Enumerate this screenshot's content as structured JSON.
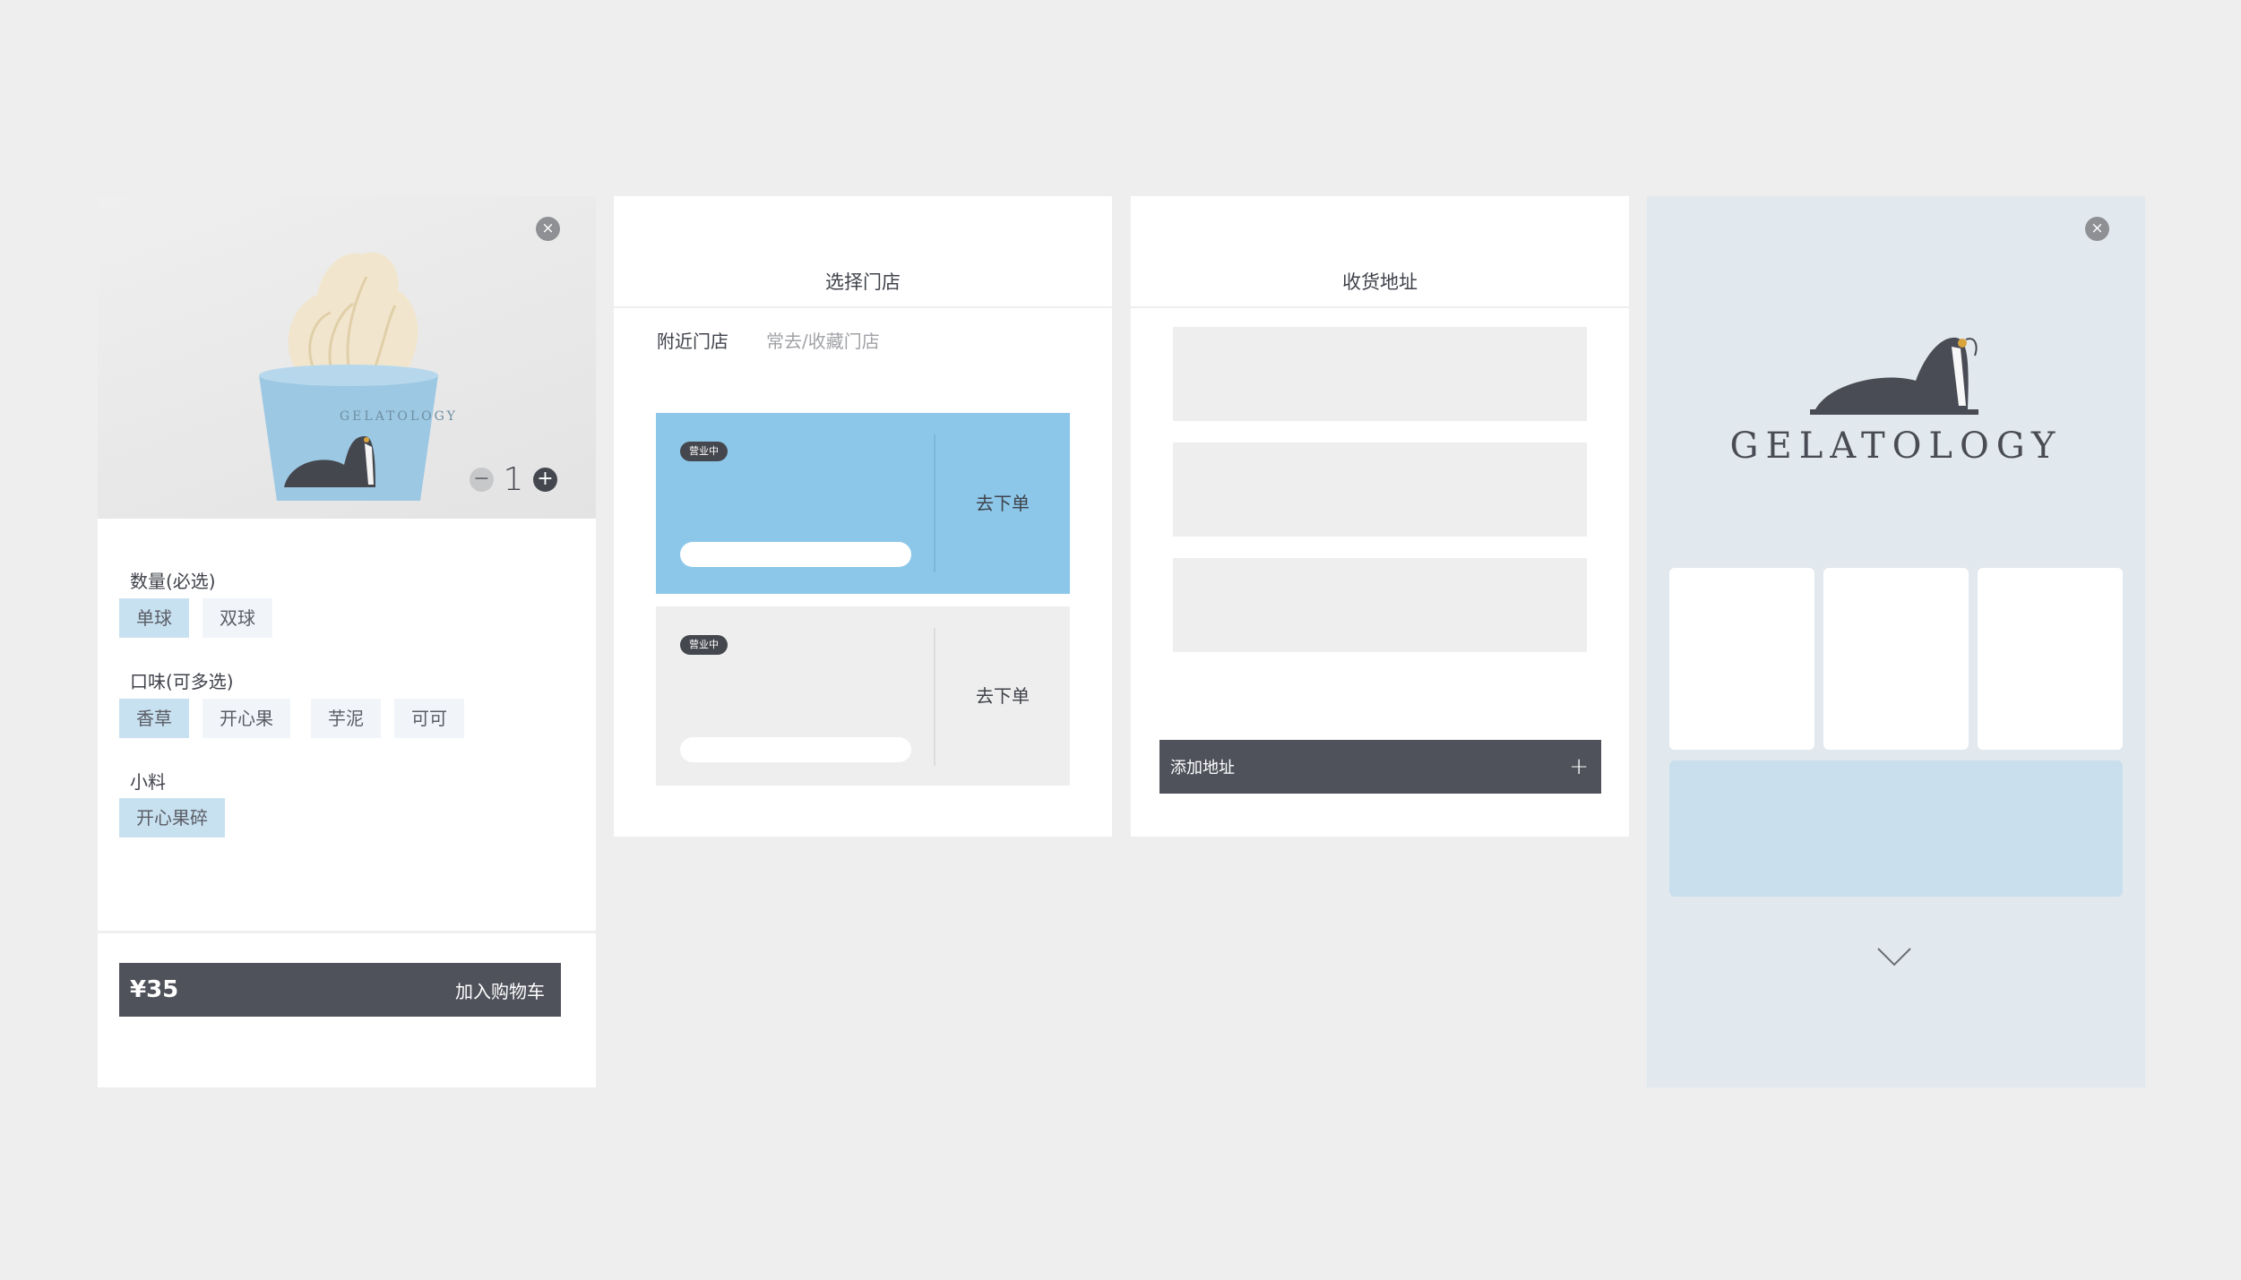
{
  "product": {
    "cup_brand": "GELATOLOGY",
    "quantity": "1",
    "sections": [
      {
        "label": "数量(必选)",
        "options": [
          {
            "label": "单球",
            "selected": true
          },
          {
            "label": "双球",
            "selected": false
          }
        ]
      },
      {
        "label": "口味(可多选)",
        "options": [
          {
            "label": "香草",
            "selected": true
          },
          {
            "label": "开心果",
            "selected": false
          },
          {
            "label": "芋泥",
            "selected": false
          },
          {
            "label": "可可",
            "selected": false
          }
        ]
      },
      {
        "label": "小料",
        "options": [
          {
            "label": "开心果碎",
            "selected": true
          }
        ]
      }
    ],
    "price": "¥35",
    "add_to_cart": "加入购物车"
  },
  "store_select": {
    "title": "选择门店",
    "tabs": [
      "附近门店",
      "常去/收藏门店"
    ],
    "stores": [
      {
        "badge": "营业中",
        "action": "去下单",
        "active": true
      },
      {
        "badge": "营业中",
        "action": "去下单",
        "active": false
      }
    ]
  },
  "address": {
    "title": "收货地址",
    "add_label": "添加地址"
  },
  "home": {
    "brand": "GELATOLOGY"
  },
  "colors": {
    "background": "#eeeeee",
    "accent_blue": "#8cc7ea",
    "light_blue": "#c8e1f1",
    "dark_bar": "#50525b",
    "home_bg": "#e1e8ee"
  },
  "icons": [
    "close-icon",
    "minus-icon",
    "plus-icon",
    "seal-logo-icon",
    "chevron-down-icon"
  ]
}
